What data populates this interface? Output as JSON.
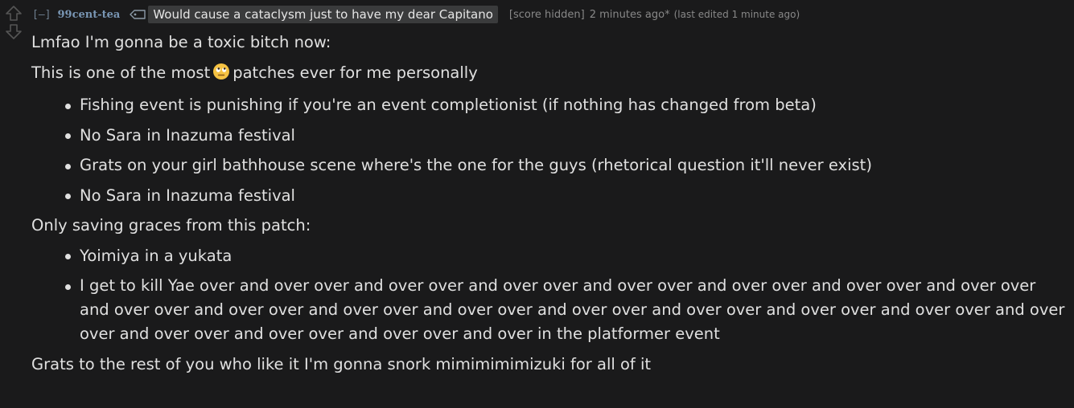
{
  "comment": {
    "expand_label": "[–]",
    "author": "99cent-tea",
    "flair": "Would cause a cataclysm just to have my dear Capitano",
    "score": "[score hidden]",
    "time": "2 minutes ago*",
    "edited": "(last edited 1 minute ago)",
    "body": {
      "p1": "Lmfao I'm gonna be a toxic bitch now:",
      "p2_before": "This is one of the most",
      "p2_emoji": "face-with-rolling-eyes-emoji",
      "p2_after": "patches ever for me personally",
      "list1": [
        "Fishing event is punishing if you're an event completionist (if nothing has changed from beta)",
        "No Sara in Inazuma festival",
        "Grats on your girl bathhouse scene where's the one for the guys (rhetorical question it'll never exist)",
        "No Sara in Inazuma festival"
      ],
      "p3": "Only saving graces from this patch:",
      "list2": [
        "Yoimiya in a yukata",
        "I get to kill Yae over and over over and over over and over over and over over and over over and over over and over over and over over and over over and over over and over over and over over and over over and over over and over over and over over and over over and over over and over over and over in the platformer event"
      ],
      "p4": "Grats to the rest of you who like it I'm gonna snork mimimimimizuki for all of it"
    }
  },
  "colors": {
    "background": "#1a1a1b",
    "author": "#7996b4",
    "flair_bg": "#3a3b3c",
    "meta": "#888888",
    "text": "#e0e0e0",
    "emoji_face": "#f6c343"
  },
  "icons": {
    "upvote": "upvote-arrow-icon",
    "downvote": "downvote-arrow-icon",
    "flair": "tag-icon"
  }
}
